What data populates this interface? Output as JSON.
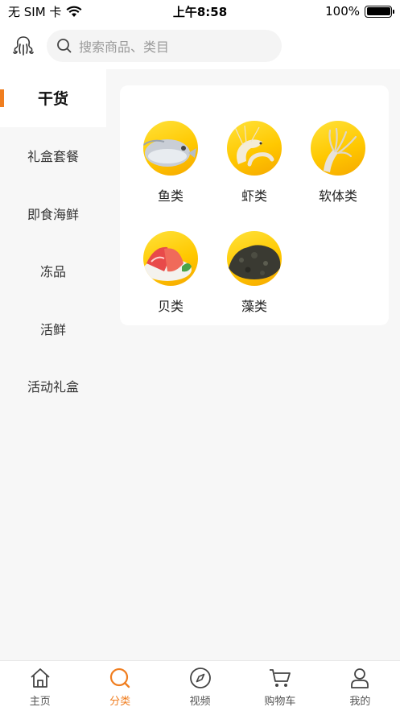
{
  "status_bar": {
    "carrier": "无 SIM 卡",
    "time": "上午8:58",
    "battery": "100%"
  },
  "search": {
    "placeholder": "搜索商品、类目"
  },
  "sidebar": {
    "items": [
      {
        "label": "干货",
        "active": true
      },
      {
        "label": "礼盒套餐"
      },
      {
        "label": "即食海鲜"
      },
      {
        "label": "冻品"
      },
      {
        "label": "活鲜"
      },
      {
        "label": "活动礼盒"
      }
    ]
  },
  "categories": [
    {
      "label": "鱼类",
      "icon": "fish-image"
    },
    {
      "label": "虾类",
      "icon": "shrimp-image"
    },
    {
      "label": "软体类",
      "icon": "squid-image"
    },
    {
      "label": "贝类",
      "icon": "shellfish-image"
    },
    {
      "label": "藻类",
      "icon": "seaweed-image"
    }
  ],
  "tabbar": {
    "tabs": [
      {
        "label": "主页",
        "icon": "home-icon"
      },
      {
        "label": "分类",
        "icon": "category-search-icon",
        "active": true
      },
      {
        "label": "视频",
        "icon": "compass-icon"
      },
      {
        "label": "购物车",
        "icon": "cart-icon"
      },
      {
        "label": "我的",
        "icon": "user-icon"
      }
    ]
  },
  "colors": {
    "accent": "#f07e20",
    "category_circle": "#ffcc00"
  }
}
